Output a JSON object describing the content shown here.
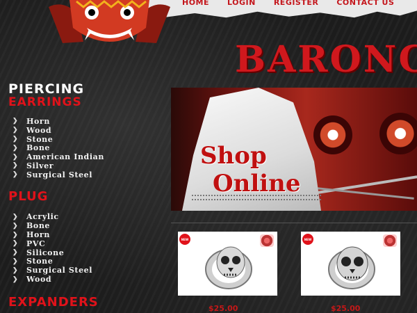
{
  "nav": {
    "items": [
      "HOME",
      "LOGIN",
      "REGISTER",
      "CONTACT US"
    ]
  },
  "brand": {
    "title": "BARONG"
  },
  "hero": {
    "line1": "Shop",
    "line2": "Online"
  },
  "sidebar": {
    "piercing": {
      "title_top": "PIERCING",
      "title_bottom": "EARRINGS",
      "items": [
        "Horn",
        "Wood",
        "Stone",
        "Bone",
        "American Indian",
        "Silver",
        "Surgical Steel"
      ]
    },
    "plug": {
      "title": "PLUG",
      "items": [
        "Acrylic",
        "Bone",
        "Horn",
        "PVC",
        "Silicone",
        "Stone",
        "Surgical Steel",
        "Wood"
      ]
    },
    "expanders": {
      "title": "EXPANDERS"
    }
  },
  "products": [
    {
      "badge": "NEW",
      "price": "$25.00"
    },
    {
      "badge": "NEW",
      "price": "$25.00"
    }
  ],
  "colors": {
    "accent": "#d0181d",
    "bg": "#1c1c1c"
  },
  "icons": {
    "bullet": "chevron-right-icon"
  }
}
